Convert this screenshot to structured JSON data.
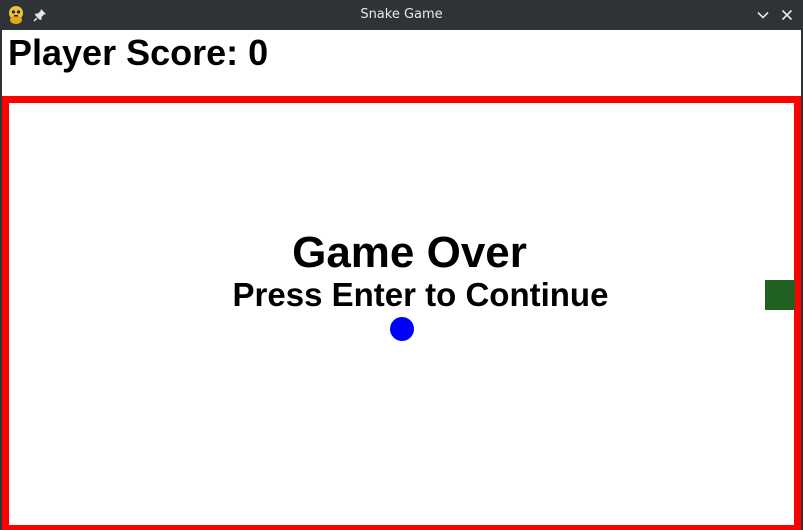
{
  "window": {
    "title": "Snake Game",
    "icons": [
      "app-icon",
      "pin-icon",
      "chevron-down-icon",
      "close-icon"
    ]
  },
  "game": {
    "score_text": "Player Score: 0",
    "game_over_text": "Game Over",
    "continue_text": "Press Enter to Continue",
    "colors": {
      "border": "#ff0000",
      "food": "#0000ff",
      "snake": "#206020",
      "background": "#ffffff",
      "text": "#000000"
    }
  }
}
